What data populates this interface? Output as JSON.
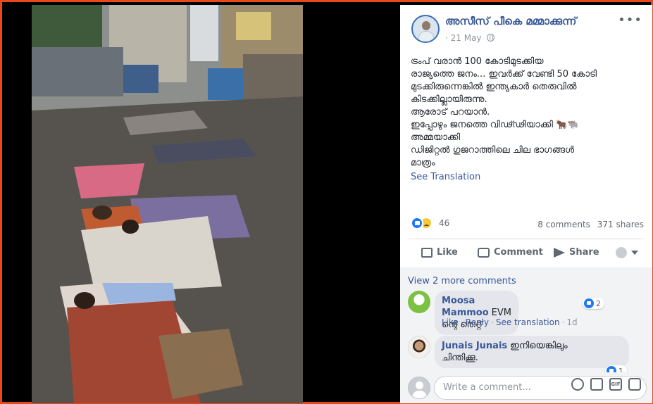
{
  "post": {
    "author": "അസീസ് പീകെ മമ്മാക്കുന്ന്",
    "date": "21 May",
    "privacy_icon": "globe-icon",
    "text_lines": [
      "ട്രംപ് വരാൻ 100 കോടിമുടക്കിയ",
      "രാജ്യത്തെ ജനം... ഇവർക്ക് വേണ്ടി 50 കോടി",
      "മുടക്കിരുന്നെങ്കിൽ ഇന്ത്യകാർ തെരുവിൽ",
      "കിടക്കില്ലായിരുന്നു.",
      "ആരോട് പറയാൻ.",
      "ഇപ്പോഴും ജനത്തെ വിഢ്ഢിയാക്കി 🐂🐃",
      "അമ്മയാക്കി",
      "ഡിജിറ്റൽ ഗുജറാത്തിലെ ചില ഭാഗങ്ങൾ",
      "മാത്രം"
    ],
    "see_translation": "See Translation",
    "reaction_count": "46",
    "comments_count": "8 comments",
    "shares_count": "371 shares"
  },
  "actions": {
    "like": "Like",
    "comment": "Comment",
    "share": "Share"
  },
  "comments": {
    "view_more": "View 2 more comments",
    "items": [
      {
        "name": "Moosa Mammoo",
        "text": "EVM ന്റെ തെറ്റ്",
        "reactions": "2",
        "like": "Like",
        "reply": "Reply",
        "see_translation": "See translation",
        "time": "1d"
      },
      {
        "name": "Junais Junais",
        "text_line1": "ഇനിയെങ്കിലും",
        "text_line2": "ചിന്തിക്കൂ.",
        "reactions": "1"
      }
    ],
    "write_placeholder": "Write a comment..."
  },
  "colors": {
    "border": "#e8481c",
    "link": "#385898",
    "like_blue": "#2078f4"
  }
}
